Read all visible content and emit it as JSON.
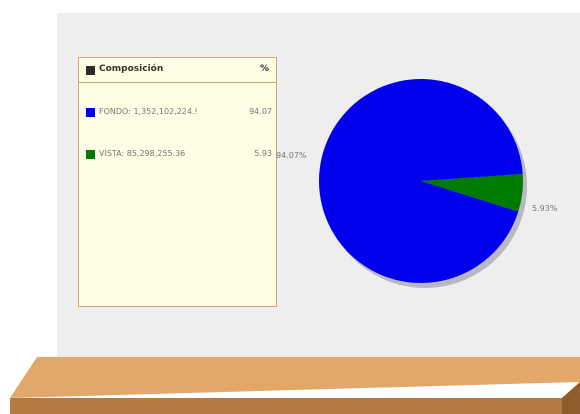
{
  "legend": {
    "title": "Composición",
    "percent_header": "%",
    "items": [
      {
        "label": "FONDO: 1,352,102,224.!",
        "pct": "94.07",
        "color": "#0000ee"
      },
      {
        "label": "VISTA: 85,298,255.36",
        "pct": "5.93",
        "color": "#007a00"
      }
    ]
  },
  "chart_data": {
    "type": "pie",
    "categories": [
      "FONDO",
      "VISTA"
    ],
    "values": [
      94.07,
      5.93
    ],
    "slice_labels": [
      "94.07%",
      "5.93%"
    ],
    "colors": [
      "#0000ee",
      "#007a00"
    ]
  }
}
